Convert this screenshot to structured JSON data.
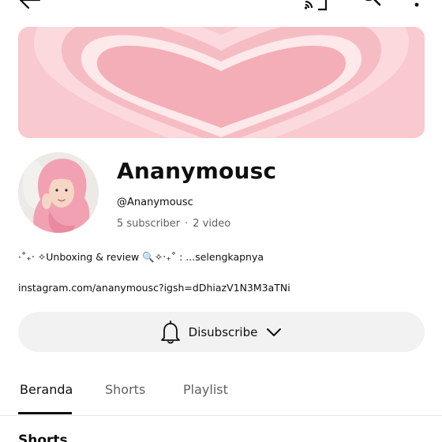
{
  "topbar": {
    "icons": [
      "back-arrow-icon",
      "cast-icon",
      "search-icon",
      "more-vert-icon"
    ]
  },
  "channel": {
    "name": "Ananymousc",
    "handle": "@Ananymousc",
    "subscribers": "5 subscriber",
    "separator": "·",
    "videos": "2 video",
    "description": "⋅˚₊‧ ✧Unboxing & review 🔍✧‧₊˚ :",
    "description_more": "...selengkapnya",
    "link": "instagram.com/ananymousc?igsh=dDhiazV1N3M3aTNi"
  },
  "subscribe": {
    "label": "Disubscribe",
    "icons": [
      "bell-icon",
      "chevron-down-icon"
    ]
  },
  "tabs": [
    {
      "label": "Beranda",
      "active": true
    },
    {
      "label": "Shorts",
      "active": false
    },
    {
      "label": "Playlist",
      "active": false
    }
  ],
  "section": {
    "title": "Shorts"
  },
  "colors": {
    "banner_bg": "#f7c7cd",
    "heart": "#f4aeb7",
    "pill_bg": "#f2f2f2",
    "text": "#0f0f0f",
    "muted": "#606060"
  }
}
